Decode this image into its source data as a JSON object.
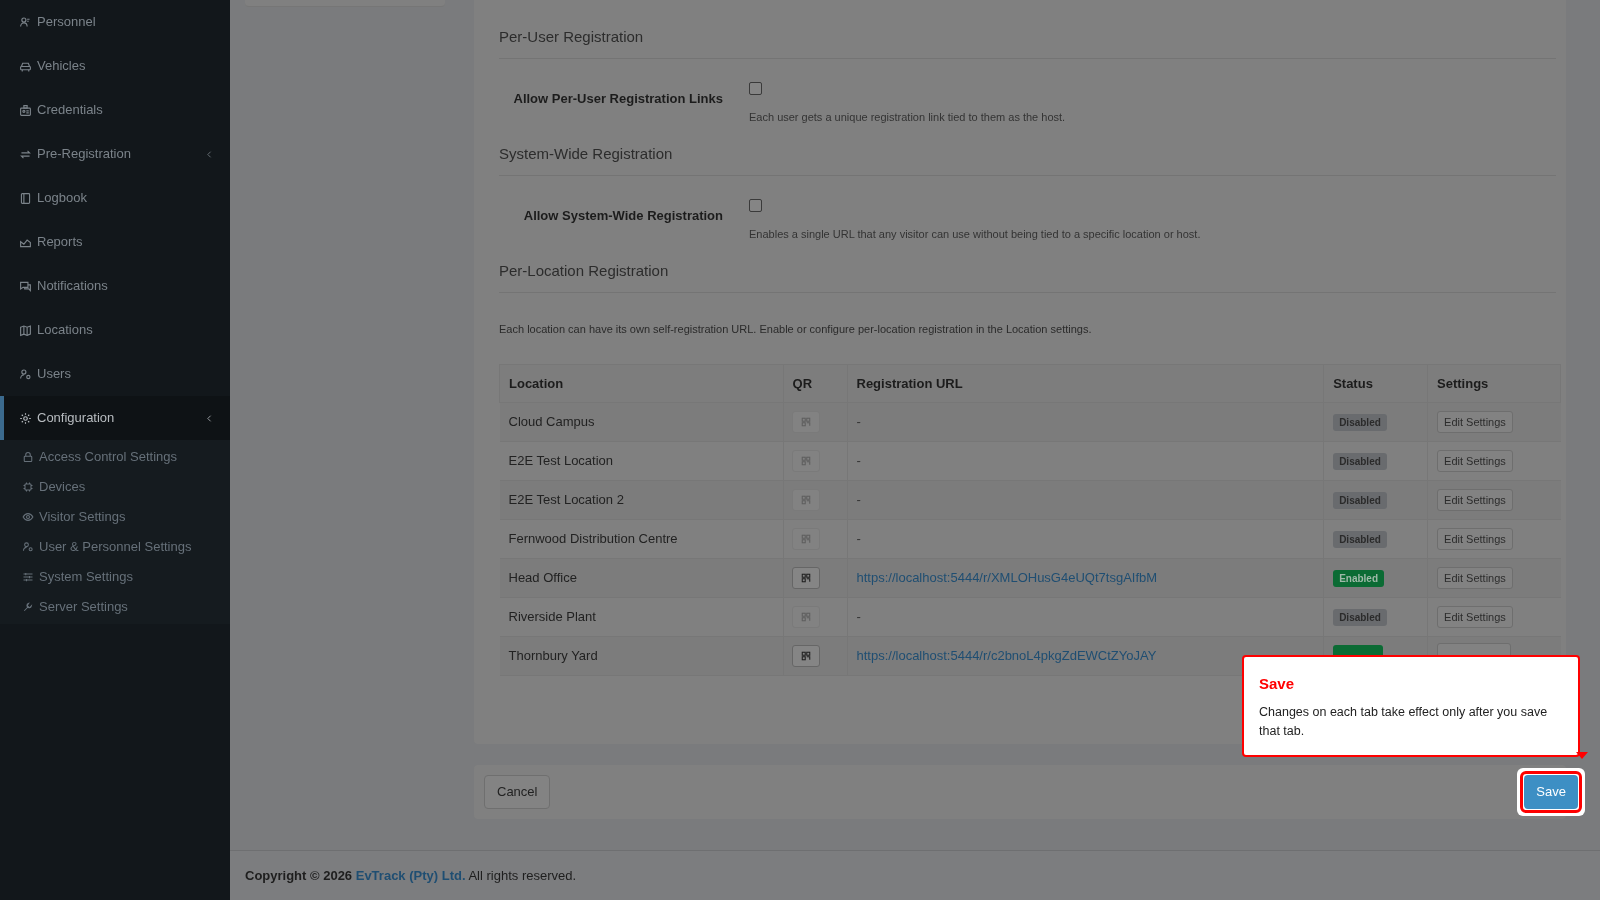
{
  "sidebar": {
    "items": [
      {
        "label": "Personnel",
        "has_submenu": false,
        "selected": false
      },
      {
        "label": "Vehicles",
        "has_submenu": false,
        "selected": false
      },
      {
        "label": "Credentials",
        "has_submenu": false,
        "selected": false
      },
      {
        "label": "Pre-Registration",
        "has_submenu": true,
        "selected": false
      },
      {
        "label": "Logbook",
        "has_submenu": false,
        "selected": false
      },
      {
        "label": "Reports",
        "has_submenu": false,
        "selected": false
      },
      {
        "label": "Notifications",
        "has_submenu": false,
        "selected": false
      },
      {
        "label": "Locations",
        "has_submenu": false,
        "selected": false
      },
      {
        "label": "Users",
        "has_submenu": false,
        "selected": false
      },
      {
        "label": "Configuration",
        "has_submenu": true,
        "selected": true,
        "children": [
          {
            "label": "Access Control Settings",
            "selected": false
          },
          {
            "label": "Devices",
            "selected": false
          },
          {
            "label": "Visitor Settings",
            "selected": false
          },
          {
            "label": "User & Personnel Settings",
            "selected": false
          },
          {
            "label": "System Settings",
            "selected": false
          },
          {
            "label": "Server Settings",
            "selected": false
          }
        ]
      }
    ]
  },
  "sections": [
    {
      "title": "Per-User Registration",
      "setting": {
        "label": "Allow Per-User Registration Links",
        "checked": false,
        "help": "Each user gets a unique registration link tied to them as the host."
      }
    },
    {
      "title": "System-Wide Registration",
      "setting": {
        "label": "Allow System-Wide Registration",
        "checked": false,
        "help": "Enables a single URL that any visitor can use without being tied to a specific location or host."
      }
    },
    {
      "title": "Per-Location Registration",
      "description": "Each location can have its own self-registration URL. Enable or configure per-location registration in the Location settings."
    }
  ],
  "table": {
    "columns": [
      "Location",
      "QR",
      "Registration URL",
      "Status",
      "Settings"
    ],
    "rows": [
      {
        "location": "Cloud Campus",
        "url": "-",
        "enabled": false,
        "status": "Disabled",
        "settings_button": "Edit Settings"
      },
      {
        "location": "E2E Test Location",
        "url": "-",
        "enabled": false,
        "status": "Disabled",
        "settings_button": "Edit Settings"
      },
      {
        "location": "E2E Test Location 2",
        "url": "-",
        "enabled": false,
        "status": "Disabled",
        "settings_button": "Edit Settings"
      },
      {
        "location": "Fernwood Distribution Centre",
        "url": "-",
        "enabled": false,
        "status": "Disabled",
        "settings_button": "Edit Settings"
      },
      {
        "location": "Head Office",
        "url": "https://localhost:5444/r/XMLOHusG4eUQt7tsgAIfbM",
        "enabled": true,
        "status": "Enabled",
        "settings_button": "Edit Settings"
      },
      {
        "location": "Riverside Plant",
        "url": "-",
        "enabled": false,
        "status": "Disabled",
        "settings_button": "Edit Settings"
      },
      {
        "location": "Thornbury Yard",
        "url": "https://localhost:5444/r/c2bnoL4pkgZdEWCtZYoJAY",
        "enabled": true
      }
    ]
  },
  "actions": {
    "cancel": "Cancel",
    "save": "Save"
  },
  "tour": {
    "title": "Save",
    "text": "Changes on each tab take effect only after you save that tab."
  },
  "footer": {
    "prefix": "Copyright © 2026",
    "company": "EvTrack (Pty) Ltd.",
    "suffix": "All rights reserved."
  }
}
